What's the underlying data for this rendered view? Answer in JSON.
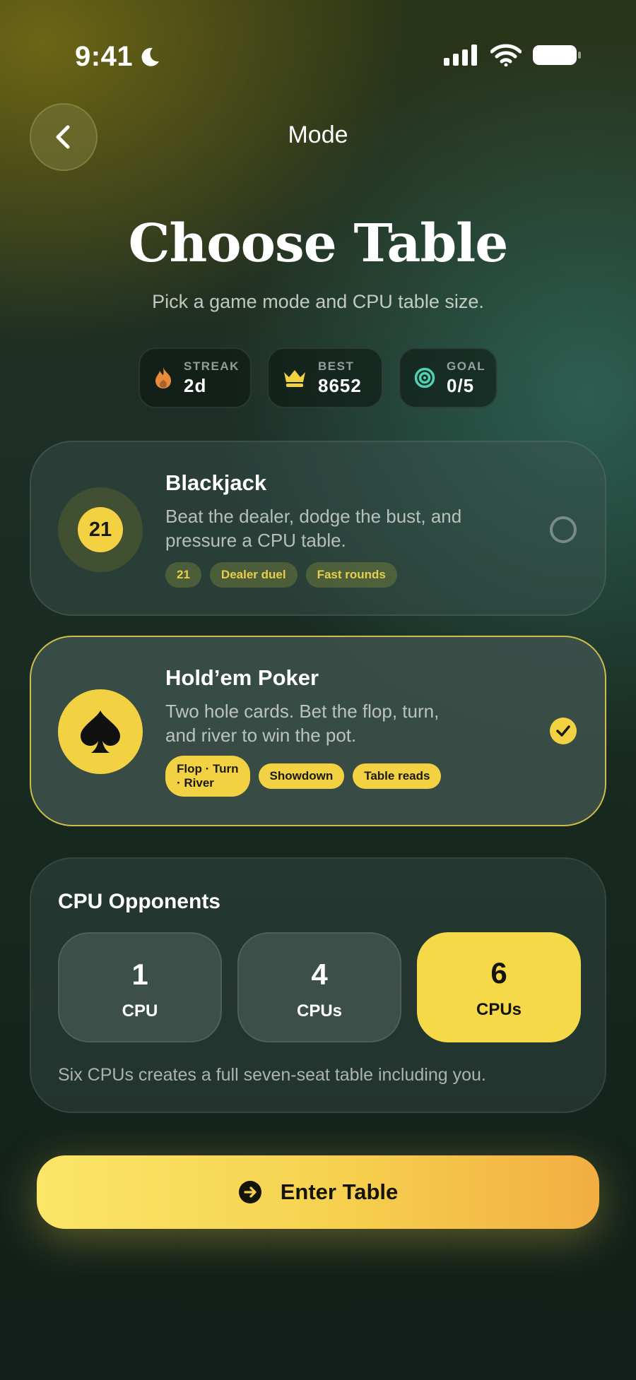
{
  "status": {
    "time": "9:41"
  },
  "header": {
    "back_icon": "chevron-left-icon",
    "title": "Mode"
  },
  "page": {
    "title": "Choose Table",
    "subtitle": "Pick a game mode and CPU table size."
  },
  "stats": [
    {
      "label": "STREAK",
      "value": "2d",
      "icon": "flame-icon",
      "color": "#e98a3c"
    },
    {
      "label": "BEST",
      "value": "8652",
      "icon": "crown-icon",
      "color": "#f2d243"
    },
    {
      "label": "GOAL",
      "value": "0/5",
      "icon": "target-icon",
      "color": "#4fd1b6"
    }
  ],
  "modes": [
    {
      "badge": "21",
      "title": "Blackjack",
      "desc_line1": "Beat the dealer, dodge the bust, and",
      "desc_line2": "pressure a CPU table.",
      "tags": [
        "21",
        "Dealer duel",
        "Fast rounds"
      ],
      "selected": false
    },
    {
      "badge_icon": "spade-icon",
      "title": "Hold’em Poker",
      "desc_line1": "Two hole cards. Bet the flop, turn,",
      "desc_line2": "and river to win the pot.",
      "tags": [
        "Flop · Turn · River",
        "Showdown",
        "Table reads"
      ],
      "tag0_line1": "Flop · Turn",
      "tag0_line2": "· River",
      "selected": true
    }
  ],
  "opponents": {
    "title": "CPU Opponents",
    "options": [
      {
        "count": "1",
        "unit": "CPU",
        "active": false
      },
      {
        "count": "4",
        "unit": "CPUs",
        "active": false
      },
      {
        "count": "6",
        "unit": "CPUs",
        "active": true
      }
    ],
    "note": "Six CPUs creates a full seven-seat table including you."
  },
  "cta": {
    "label": "Enter Table",
    "icon": "arrow-right-circle-icon"
  },
  "colors": {
    "accent": "#f2d243",
    "selected_border": "#cdbd4a"
  }
}
